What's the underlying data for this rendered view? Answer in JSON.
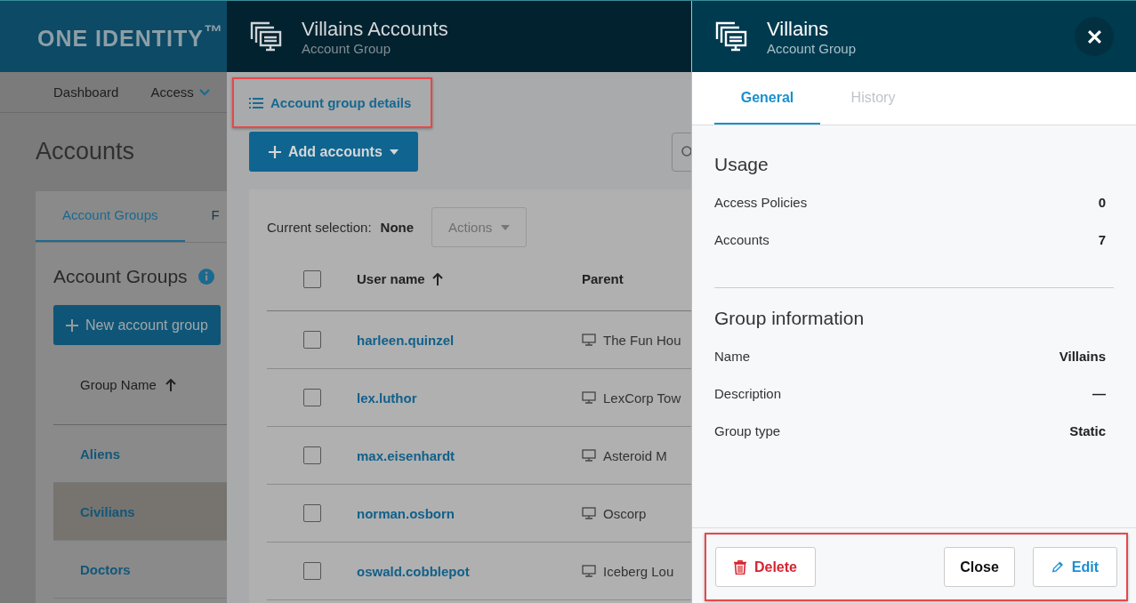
{
  "app": {
    "logo": "ONE IDENTITY$^{™}$",
    "nav": [
      {
        "label": "Dashboard",
        "has_menu": false
      },
      {
        "label": "Access",
        "has_menu": true
      }
    ],
    "page_title": "Accounts",
    "tabs": [
      {
        "label": "Account Groups",
        "selected": true
      },
      {
        "label": "F",
        "selected": false
      }
    ],
    "section_title": "Account Groups",
    "new_button": "New account group",
    "column": "Group Name",
    "rows": [
      {
        "name": "Aliens",
        "selected": false
      },
      {
        "name": "Civilians",
        "selected": true
      },
      {
        "name": "Doctors",
        "selected": false
      }
    ]
  },
  "accounts_panel": {
    "title": "Villains Accounts",
    "subtitle": "Account Group",
    "details_link": "Account group details",
    "add_button": "Add accounts",
    "selection_label": "Current selection:",
    "selection_value": "None",
    "actions_button": {
      "label": "Actions",
      "disabled": true
    },
    "columns": [
      "User name",
      "Parent"
    ],
    "all_checked": false,
    "rows": [
      {
        "user": "harleen.quinzel",
        "parent": "The Fun Hou",
        "checked": false
      },
      {
        "user": "lex.luthor",
        "parent": "LexCorp Tow",
        "checked": false
      },
      {
        "user": "max.eisenhardt",
        "parent": "Asteroid M",
        "checked": false
      },
      {
        "user": "norman.osborn",
        "parent": "Oscorp",
        "checked": false
      },
      {
        "user": "oswald.cobblepot",
        "parent": "Iceberg Lou",
        "checked": false
      }
    ]
  },
  "details_panel": {
    "title": "Villains",
    "subtitle": "Account Group",
    "tabs": [
      {
        "label": "General",
        "selected": true
      },
      {
        "label": "History",
        "selected": false
      }
    ],
    "sections": [
      {
        "title": "Usage",
        "rows": [
          {
            "label": "Access Policies",
            "value": "0"
          },
          {
            "label": "Accounts",
            "value": "7"
          }
        ]
      },
      {
        "title": "Group information",
        "rows": [
          {
            "label": "Name",
            "value": "Villains"
          },
          {
            "label": "Description",
            "value": "—"
          },
          {
            "label": "Group type",
            "value": "Static"
          }
        ]
      }
    ],
    "buttons": [
      {
        "label": "Delete",
        "kind": "delete"
      },
      {
        "label": "Close",
        "kind": "close"
      },
      {
        "label": "Edit",
        "kind": "edit"
      }
    ]
  }
}
